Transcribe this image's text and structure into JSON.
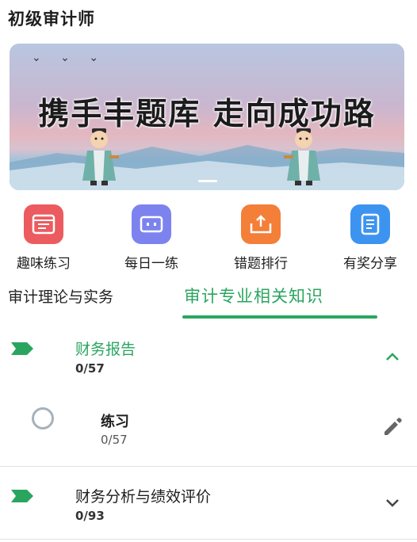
{
  "app": {
    "title": "初级审计师"
  },
  "banner": {
    "slogan": "携手丰题库 走向成功路",
    "birds": "⌄ ⌄ ⌄"
  },
  "quick_menu": [
    {
      "label": "趣味练习",
      "icon": "fun-practice-icon",
      "color": "#ec5b5f"
    },
    {
      "label": "每日一练",
      "icon": "daily-practice-icon",
      "color": "#7d83ee"
    },
    {
      "label": "错题排行",
      "icon": "wrong-ranking-icon",
      "color": "#f37f38"
    },
    {
      "label": "有奖分享",
      "icon": "reward-share-icon",
      "color": "#3d94f0"
    }
  ],
  "tabs": [
    {
      "label": "审计理论与实务",
      "active": false
    },
    {
      "label": "审计专业相关知识",
      "active": true
    }
  ],
  "accent_color": "#2aa560",
  "chapters": [
    {
      "title": "财务报告",
      "count": "0/57",
      "expanded": true
    },
    {
      "title": "财务分析与绩效评价",
      "count": "0/93",
      "expanded": false
    }
  ],
  "exercise": {
    "title": "练习",
    "count": "0/57"
  }
}
